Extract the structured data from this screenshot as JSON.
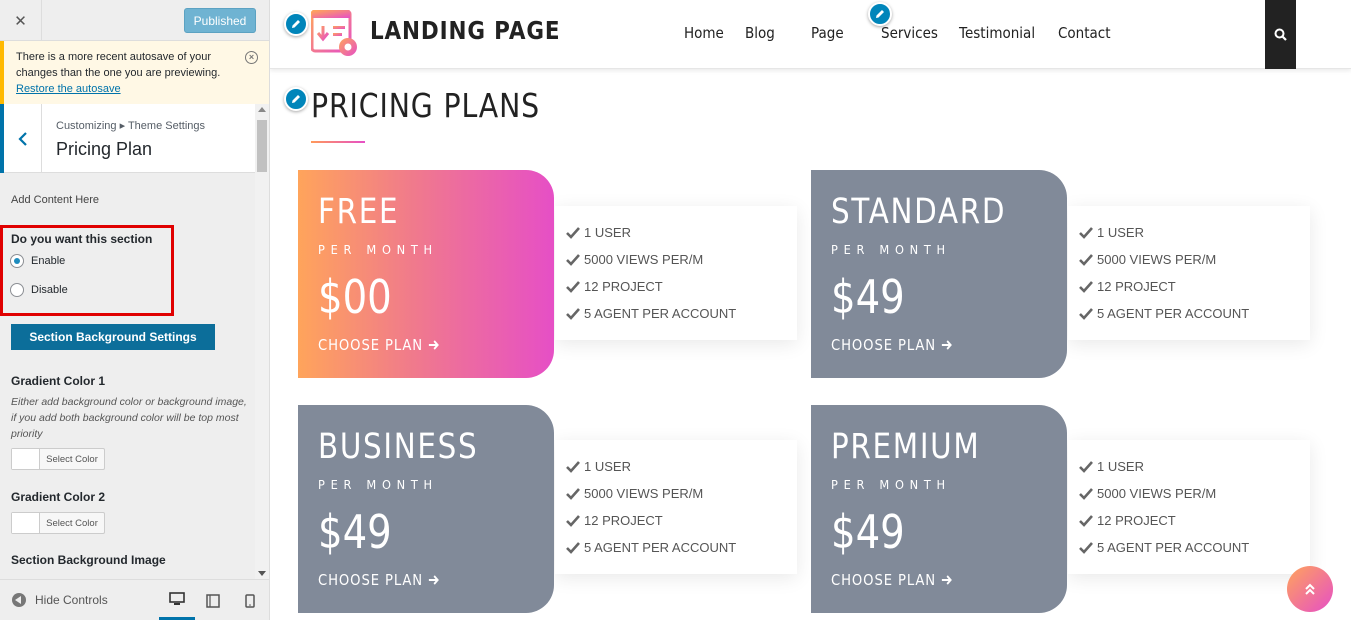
{
  "sidebar": {
    "close_icon": "close-icon",
    "published_label": "Published",
    "notice": {
      "text": "There is a more recent autosave of your changes than the one you are previewing.",
      "link": "Restore the autosave"
    },
    "breadcrumb": "Customizing ▸ Theme Settings",
    "panel_title": "Pricing Plan",
    "add_content": "Add Content Here",
    "section_question": "Do you want this section",
    "options": [
      {
        "label": "Enable",
        "checked": true
      },
      {
        "label": "Disable",
        "checked": false
      }
    ],
    "bg_settings_label": "Section Background Settings",
    "gradient1": {
      "label": "Gradient Color 1",
      "desc": "Either add background color or background image, if you add both background color will be top most priority",
      "button": "Select Color"
    },
    "gradient2": {
      "label": "Gradient Color 2",
      "button": "Select Color"
    },
    "bg_image_label": "Section Background Image",
    "footer": {
      "hide_controls": "Hide Controls",
      "devices": [
        "desktop",
        "tablet",
        "mobile"
      ],
      "active_device": "desktop"
    }
  },
  "site": {
    "logo_text": "LANDING PAGE",
    "nav": [
      "Home",
      "Blog",
      "Page",
      "Services",
      "Testimonial",
      "Contact"
    ],
    "section_title": "PRICING PLANS",
    "accent_start": "#ffa45b",
    "accent_end": "#e64fc6",
    "plan_grey": "#818a99"
  },
  "plans": [
    {
      "name": "FREE",
      "period": "PER MONTH",
      "price": "$00",
      "cta": "CHOOSE PLAN",
      "style": "gradient",
      "features": [
        "1 USER",
        "5000 VIEWS PER/M",
        "12 PROJECT",
        "5 AGENT PER ACCOUNT"
      ]
    },
    {
      "name": "STANDARD",
      "period": "PER MONTH",
      "price": "$49",
      "cta": "CHOOSE PLAN",
      "style": "grey",
      "features": [
        "1 USER",
        "5000 VIEWS PER/M",
        "12 PROJECT",
        "5 AGENT PER ACCOUNT"
      ]
    },
    {
      "name": "BUSINESS",
      "period": "PER MONTH",
      "price": "$49",
      "cta": "CHOOSE PLAN",
      "style": "grey",
      "features": [
        "1 USER",
        "5000 VIEWS PER/M",
        "12 PROJECT",
        "5 AGENT PER ACCOUNT"
      ]
    },
    {
      "name": "PREMIUM",
      "period": "PER MONTH",
      "price": "$49",
      "cta": "CHOOSE PLAN",
      "style": "grey",
      "features": [
        "1 USER",
        "5000 VIEWS PER/M",
        "12 PROJECT",
        "5 AGENT PER ACCOUNT"
      ]
    }
  ]
}
